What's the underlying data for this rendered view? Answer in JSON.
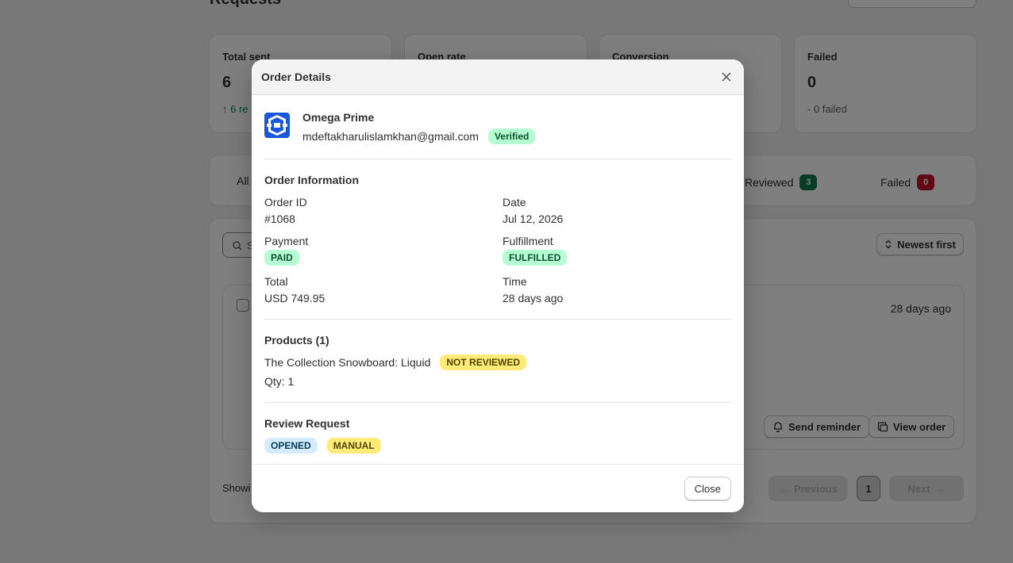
{
  "background": {
    "page_title": "Requests",
    "stats": [
      {
        "label": "Total sent",
        "value": "6",
        "sub": "↑ 6 re"
      },
      {
        "label": "Open rate",
        "value": "",
        "sub": ""
      },
      {
        "label": "Conversion",
        "value": "",
        "sub": ""
      },
      {
        "label": "Failed",
        "value": "0",
        "sub": "- 0 failed"
      }
    ],
    "tabs": {
      "all": "All",
      "reviewed": "Reviewed",
      "reviewed_count": "3",
      "failed": "Failed",
      "failed_count": "0"
    },
    "sort_label": "Newest first",
    "row_time": "28 days ago",
    "send_reminder": "Send reminder",
    "view_order": "View order",
    "showing": "Showi",
    "previous": "Previous",
    "page": "1",
    "next": "Next",
    "search_placeholder": "S"
  },
  "modal": {
    "title": "Order Details",
    "customer": {
      "name": "Omega Prime",
      "email": "mdeftakharulislamkhan@gmail.com",
      "status": "Verified"
    },
    "order_info": {
      "title": "Order Information",
      "order_id_label": "Order ID",
      "order_id": "#1068",
      "date_label": "Date",
      "date": "Jul 12, 2026",
      "payment_label": "Payment",
      "payment": "PAID",
      "fulfillment_label": "Fulfillment",
      "fulfillment": "FULFILLED",
      "total_label": "Total",
      "total": "USD 749.95",
      "time_label": "Time",
      "time": "28 days ago"
    },
    "products": {
      "title": "Products (1)",
      "items": [
        {
          "name": "The Collection Snowboard: Liquid",
          "status": "NOT REVIEWED",
          "qty": "Qty: 1"
        }
      ]
    },
    "review_request": {
      "title": "Review Request",
      "status": "OPENED",
      "type": "MANUAL"
    },
    "close_label": "Close"
  },
  "colors": {
    "overlay": "#00000080",
    "badge_green": "#b4fed2",
    "badge_yellow": "#ffeb78",
    "badge_blue": "#d5ebff",
    "count_green": "#0f7a4f",
    "count_red": "#c5112c",
    "logo_blue": "#1a56db"
  }
}
